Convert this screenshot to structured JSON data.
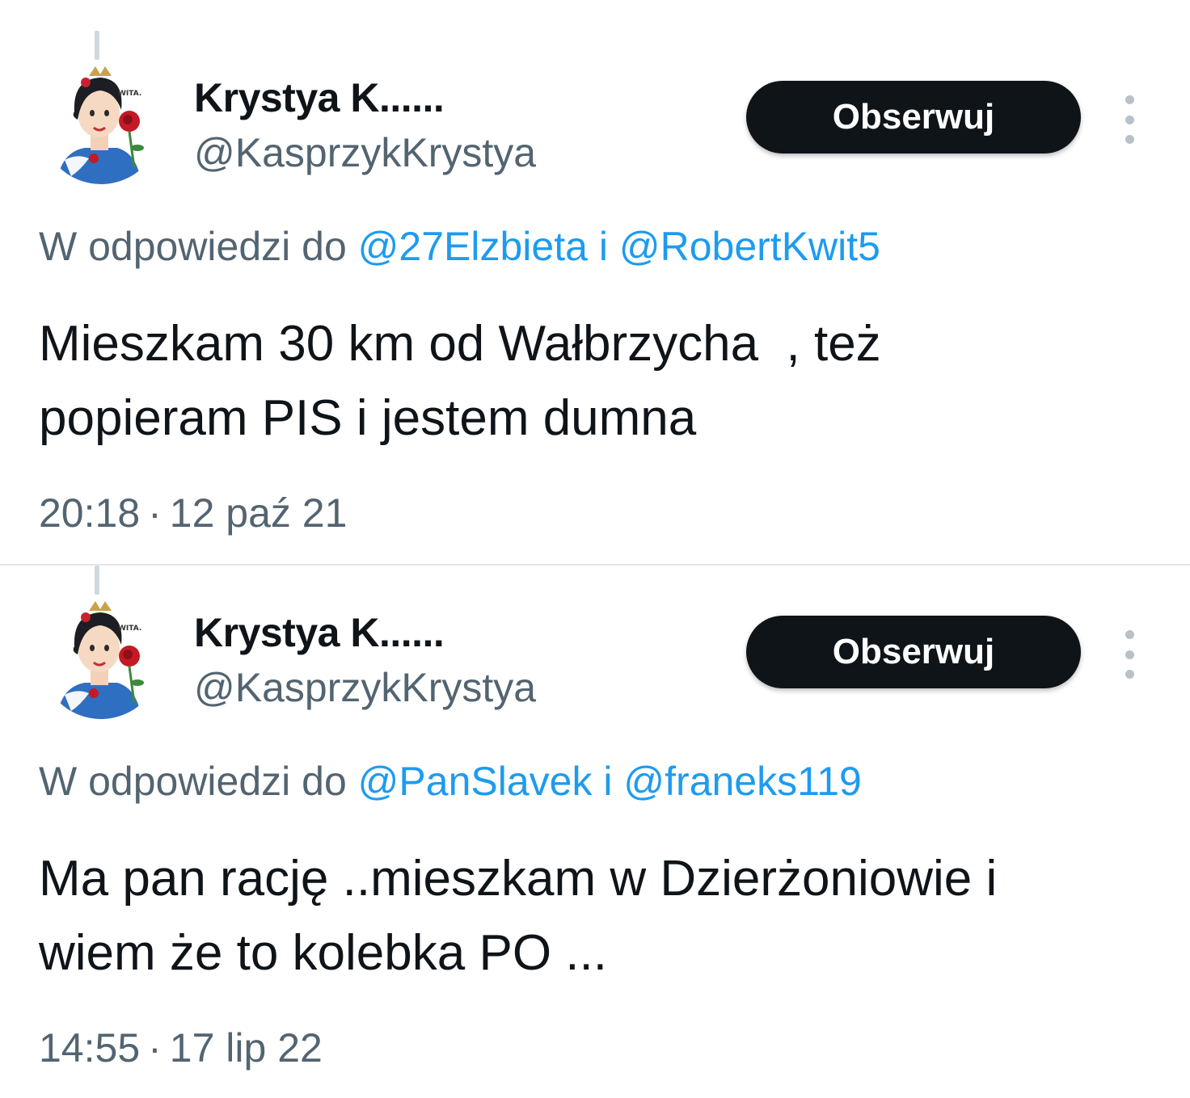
{
  "colors": {
    "text_primary": "#0f1419",
    "text_secondary": "#536471",
    "link": "#1d9bf0",
    "follow_button_bg": "#0f1419",
    "follow_button_text": "#ffffff",
    "divider": "#e3e7ea"
  },
  "tweets": [
    {
      "avatar_text": "WITA.",
      "display_name": "Krystya K......",
      "handle": "@KasprzykKrystya",
      "follow_label": "Obserwuj",
      "more_icon": "more-vertical-icon",
      "reply_prefix": "W odpowiedzi do",
      "reply_mentions": [
        "@27Elzbieta",
        "@RobertKwit5"
      ],
      "reply_joiner": "i",
      "text": "Mieszkam 30 km od Wałbrzycha  , też\npopieram PIS i jestem dumna",
      "time": "20:18",
      "date": "12 paź 21",
      "meta_separator": "·"
    },
    {
      "avatar_text": "WITA.",
      "display_name": "Krystya K......",
      "handle": "@KasprzykKrystya",
      "follow_label": "Obserwuj",
      "more_icon": "more-vertical-icon",
      "reply_prefix": "W odpowiedzi do",
      "reply_mentions": [
        "@PanSlavek",
        "@franeks119"
      ],
      "reply_joiner": "i",
      "text": "Ma pan rację ..mieszkam w Dzierżoniowie i\nwiem że to kolebka PO ...",
      "time": "14:55",
      "date": "17 lip 22",
      "meta_separator": "·"
    }
  ]
}
